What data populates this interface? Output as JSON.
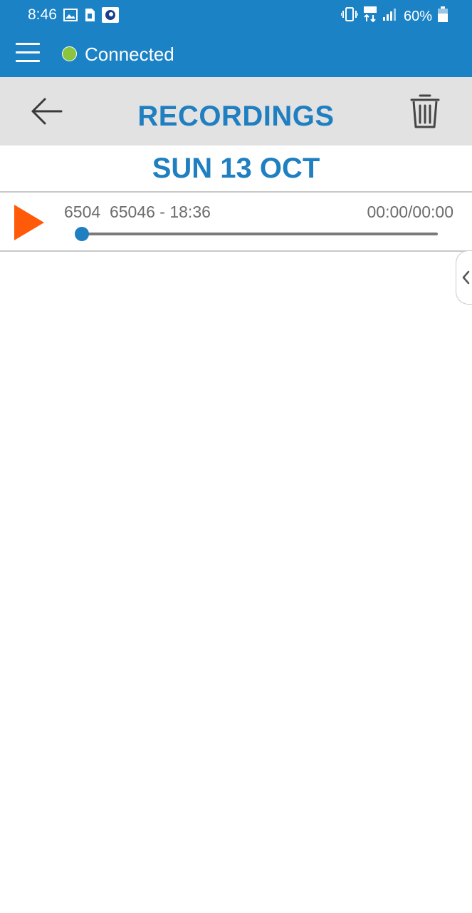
{
  "status_bar": {
    "time": "8:46",
    "battery_percent": "60%",
    "icons": [
      "image-icon",
      "sim-icon",
      "app-icon",
      "vibrate-icon",
      "lte-icon",
      "signal-icon",
      "battery-icon"
    ]
  },
  "app_bar": {
    "connection_status": "Connected",
    "connection_color": "#8bc53f",
    "background": "#1b82c5"
  },
  "header": {
    "title": "RECORDINGS",
    "accent": "#1f7fc0"
  },
  "recordings": {
    "date_label": "SUN 13 OCT",
    "items": [
      {
        "title": "6504  65046 - 18:36",
        "time": "00:00/00:00",
        "progress": 0,
        "play_color": "#ff5a0a"
      }
    ]
  }
}
